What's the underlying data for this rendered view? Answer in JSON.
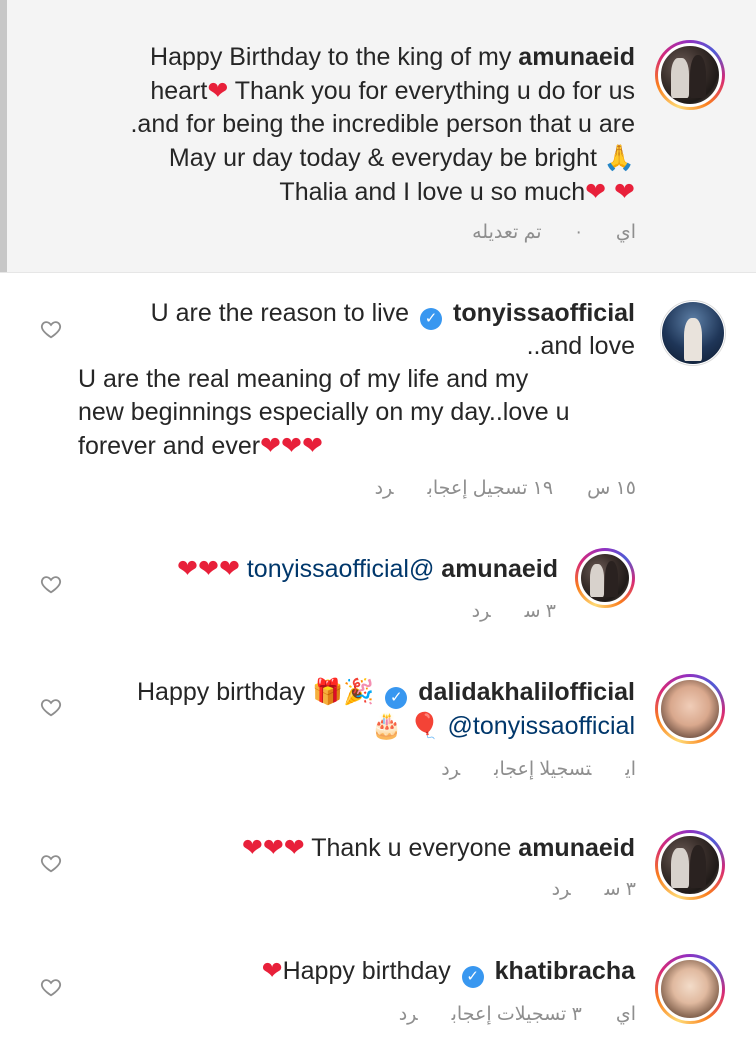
{
  "caption": {
    "username": "amunaeid",
    "line1_text": "Happy Birthday to the king of my",
    "line2_text": "heart",
    "line2_rest": "Thank you for everything u do for us",
    "line3": ".and for being the incredible person that u are",
    "line4": "May ur day today & everyday be bright",
    "line5": "Thalia and I love u so much",
    "meta_time": "اي",
    "meta_edited": "تم تعديله"
  },
  "comments": [
    {
      "username": "tonyissaofficial",
      "line1": "U are the reason to live",
      "line2": "..and love",
      "line3": "U are the real meaning of my life and my",
      "line4": "new beginnings especially on my day..love u",
      "line5": "forever and ever",
      "time": "١٥ س",
      "likes": "١٩ تسجيل إعجاب",
      "reply": "رد"
    },
    {
      "username": "amunaeid",
      "mention": "tonyissaofficial@",
      "time": "٣ س",
      "reply": "رد"
    },
    {
      "username": "dalidakhalilofficial",
      "line1": "Happy birthday",
      "mention": "@tonyissaofficial",
      "time": "اي",
      "likes": "تسجيلا إعجاب",
      "reply": "رد"
    },
    {
      "username": "amunaeid",
      "text": "Thank u everyone",
      "time": "٣ س",
      "reply": "رد"
    },
    {
      "username": "khatibracha",
      "text": "Happy birthday",
      "time": "اي",
      "likes": "٣ تسجيلات إعجاب",
      "reply": "رد"
    }
  ],
  "colors": {
    "text": "#262626",
    "meta": "#8e8e8e",
    "mention": "#00376b",
    "verified": "#3897f0",
    "heart": "#e8203a"
  }
}
